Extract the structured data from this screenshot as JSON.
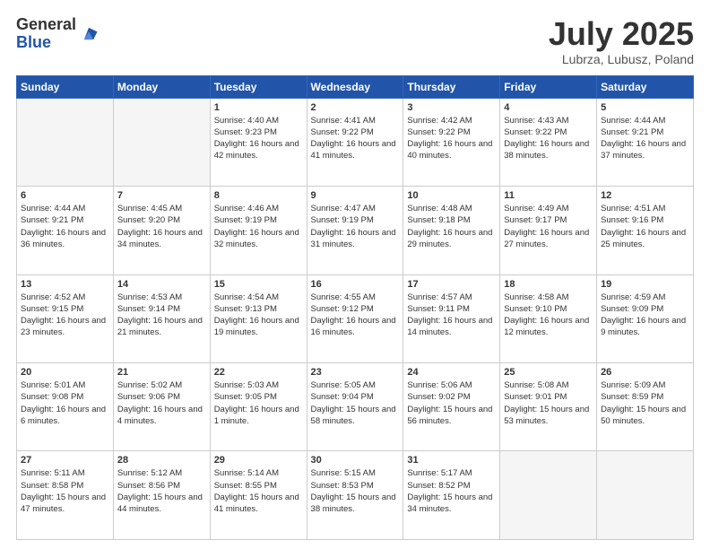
{
  "logo": {
    "general": "General",
    "blue": "Blue"
  },
  "title": "July 2025",
  "location": "Lubrza, Lubusz, Poland",
  "headers": [
    "Sunday",
    "Monday",
    "Tuesday",
    "Wednesday",
    "Thursday",
    "Friday",
    "Saturday"
  ],
  "weeks": [
    [
      {
        "day": "",
        "sunrise": "",
        "sunset": "",
        "daylight": ""
      },
      {
        "day": "",
        "sunrise": "",
        "sunset": "",
        "daylight": ""
      },
      {
        "day": "1",
        "sunrise": "Sunrise: 4:40 AM",
        "sunset": "Sunset: 9:23 PM",
        "daylight": "Daylight: 16 hours and 42 minutes."
      },
      {
        "day": "2",
        "sunrise": "Sunrise: 4:41 AM",
        "sunset": "Sunset: 9:22 PM",
        "daylight": "Daylight: 16 hours and 41 minutes."
      },
      {
        "day": "3",
        "sunrise": "Sunrise: 4:42 AM",
        "sunset": "Sunset: 9:22 PM",
        "daylight": "Daylight: 16 hours and 40 minutes."
      },
      {
        "day": "4",
        "sunrise": "Sunrise: 4:43 AM",
        "sunset": "Sunset: 9:22 PM",
        "daylight": "Daylight: 16 hours and 38 minutes."
      },
      {
        "day": "5",
        "sunrise": "Sunrise: 4:44 AM",
        "sunset": "Sunset: 9:21 PM",
        "daylight": "Daylight: 16 hours and 37 minutes."
      }
    ],
    [
      {
        "day": "6",
        "sunrise": "Sunrise: 4:44 AM",
        "sunset": "Sunset: 9:21 PM",
        "daylight": "Daylight: 16 hours and 36 minutes."
      },
      {
        "day": "7",
        "sunrise": "Sunrise: 4:45 AM",
        "sunset": "Sunset: 9:20 PM",
        "daylight": "Daylight: 16 hours and 34 minutes."
      },
      {
        "day": "8",
        "sunrise": "Sunrise: 4:46 AM",
        "sunset": "Sunset: 9:19 PM",
        "daylight": "Daylight: 16 hours and 32 minutes."
      },
      {
        "day": "9",
        "sunrise": "Sunrise: 4:47 AM",
        "sunset": "Sunset: 9:19 PM",
        "daylight": "Daylight: 16 hours and 31 minutes."
      },
      {
        "day": "10",
        "sunrise": "Sunrise: 4:48 AM",
        "sunset": "Sunset: 9:18 PM",
        "daylight": "Daylight: 16 hours and 29 minutes."
      },
      {
        "day": "11",
        "sunrise": "Sunrise: 4:49 AM",
        "sunset": "Sunset: 9:17 PM",
        "daylight": "Daylight: 16 hours and 27 minutes."
      },
      {
        "day": "12",
        "sunrise": "Sunrise: 4:51 AM",
        "sunset": "Sunset: 9:16 PM",
        "daylight": "Daylight: 16 hours and 25 minutes."
      }
    ],
    [
      {
        "day": "13",
        "sunrise": "Sunrise: 4:52 AM",
        "sunset": "Sunset: 9:15 PM",
        "daylight": "Daylight: 16 hours and 23 minutes."
      },
      {
        "day": "14",
        "sunrise": "Sunrise: 4:53 AM",
        "sunset": "Sunset: 9:14 PM",
        "daylight": "Daylight: 16 hours and 21 minutes."
      },
      {
        "day": "15",
        "sunrise": "Sunrise: 4:54 AM",
        "sunset": "Sunset: 9:13 PM",
        "daylight": "Daylight: 16 hours and 19 minutes."
      },
      {
        "day": "16",
        "sunrise": "Sunrise: 4:55 AM",
        "sunset": "Sunset: 9:12 PM",
        "daylight": "Daylight: 16 hours and 16 minutes."
      },
      {
        "day": "17",
        "sunrise": "Sunrise: 4:57 AM",
        "sunset": "Sunset: 9:11 PM",
        "daylight": "Daylight: 16 hours and 14 minutes."
      },
      {
        "day": "18",
        "sunrise": "Sunrise: 4:58 AM",
        "sunset": "Sunset: 9:10 PM",
        "daylight": "Daylight: 16 hours and 12 minutes."
      },
      {
        "day": "19",
        "sunrise": "Sunrise: 4:59 AM",
        "sunset": "Sunset: 9:09 PM",
        "daylight": "Daylight: 16 hours and 9 minutes."
      }
    ],
    [
      {
        "day": "20",
        "sunrise": "Sunrise: 5:01 AM",
        "sunset": "Sunset: 9:08 PM",
        "daylight": "Daylight: 16 hours and 6 minutes."
      },
      {
        "day": "21",
        "sunrise": "Sunrise: 5:02 AM",
        "sunset": "Sunset: 9:06 PM",
        "daylight": "Daylight: 16 hours and 4 minutes."
      },
      {
        "day": "22",
        "sunrise": "Sunrise: 5:03 AM",
        "sunset": "Sunset: 9:05 PM",
        "daylight": "Daylight: 16 hours and 1 minute."
      },
      {
        "day": "23",
        "sunrise": "Sunrise: 5:05 AM",
        "sunset": "Sunset: 9:04 PM",
        "daylight": "Daylight: 15 hours and 58 minutes."
      },
      {
        "day": "24",
        "sunrise": "Sunrise: 5:06 AM",
        "sunset": "Sunset: 9:02 PM",
        "daylight": "Daylight: 15 hours and 56 minutes."
      },
      {
        "day": "25",
        "sunrise": "Sunrise: 5:08 AM",
        "sunset": "Sunset: 9:01 PM",
        "daylight": "Daylight: 15 hours and 53 minutes."
      },
      {
        "day": "26",
        "sunrise": "Sunrise: 5:09 AM",
        "sunset": "Sunset: 8:59 PM",
        "daylight": "Daylight: 15 hours and 50 minutes."
      }
    ],
    [
      {
        "day": "27",
        "sunrise": "Sunrise: 5:11 AM",
        "sunset": "Sunset: 8:58 PM",
        "daylight": "Daylight: 15 hours and 47 minutes."
      },
      {
        "day": "28",
        "sunrise": "Sunrise: 5:12 AM",
        "sunset": "Sunset: 8:56 PM",
        "daylight": "Daylight: 15 hours and 44 minutes."
      },
      {
        "day": "29",
        "sunrise": "Sunrise: 5:14 AM",
        "sunset": "Sunset: 8:55 PM",
        "daylight": "Daylight: 15 hours and 41 minutes."
      },
      {
        "day": "30",
        "sunrise": "Sunrise: 5:15 AM",
        "sunset": "Sunset: 8:53 PM",
        "daylight": "Daylight: 15 hours and 38 minutes."
      },
      {
        "day": "31",
        "sunrise": "Sunrise: 5:17 AM",
        "sunset": "Sunset: 8:52 PM",
        "daylight": "Daylight: 15 hours and 34 minutes."
      },
      {
        "day": "",
        "sunrise": "",
        "sunset": "",
        "daylight": ""
      },
      {
        "day": "",
        "sunrise": "",
        "sunset": "",
        "daylight": ""
      }
    ]
  ]
}
